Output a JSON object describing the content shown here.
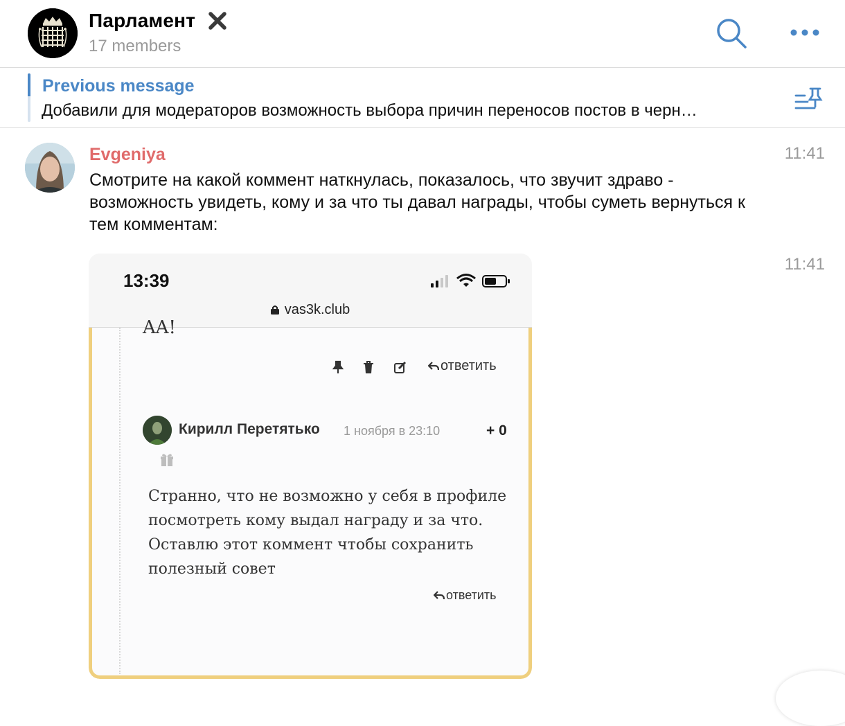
{
  "header": {
    "title": "Парламент",
    "members": "17 members",
    "search_icon": "search-icon",
    "more_icon": "more-icon",
    "mute_icon": "close-icon"
  },
  "pinned": {
    "label": "Previous message",
    "text": "Добавили для модераторов возможность выбора причин переносов постов в черн…"
  },
  "message": {
    "sender": "Evgeniya",
    "time": "11:41",
    "text": "Смотрите на какой коммент наткнулась, показалось, что звучит здраво - возможность увидеть, кому и за что ты давал награды, чтобы суметь вернуться к тем комментам:",
    "photo_time": "11:41"
  },
  "screenshot": {
    "clock": "13:39",
    "url": "vas3k.club",
    "prev_text": "AA!",
    "reply_label": "ответить",
    "comment": {
      "author": "Кирилл Перетятько",
      "date": "1 ноября в 23:10",
      "score": "+ 0",
      "text": "Странно, что не возможно у себя в профиле посмотреть кому выдал награду и за что. Оставлю этот коммент чтобы сохранить полезный совет",
      "reply_label": "ответить"
    }
  },
  "colors": {
    "accent": "#4a87c6",
    "sender": "#e06b6b",
    "muted": "#9a9a9a",
    "card_border": "#efcf7e"
  }
}
